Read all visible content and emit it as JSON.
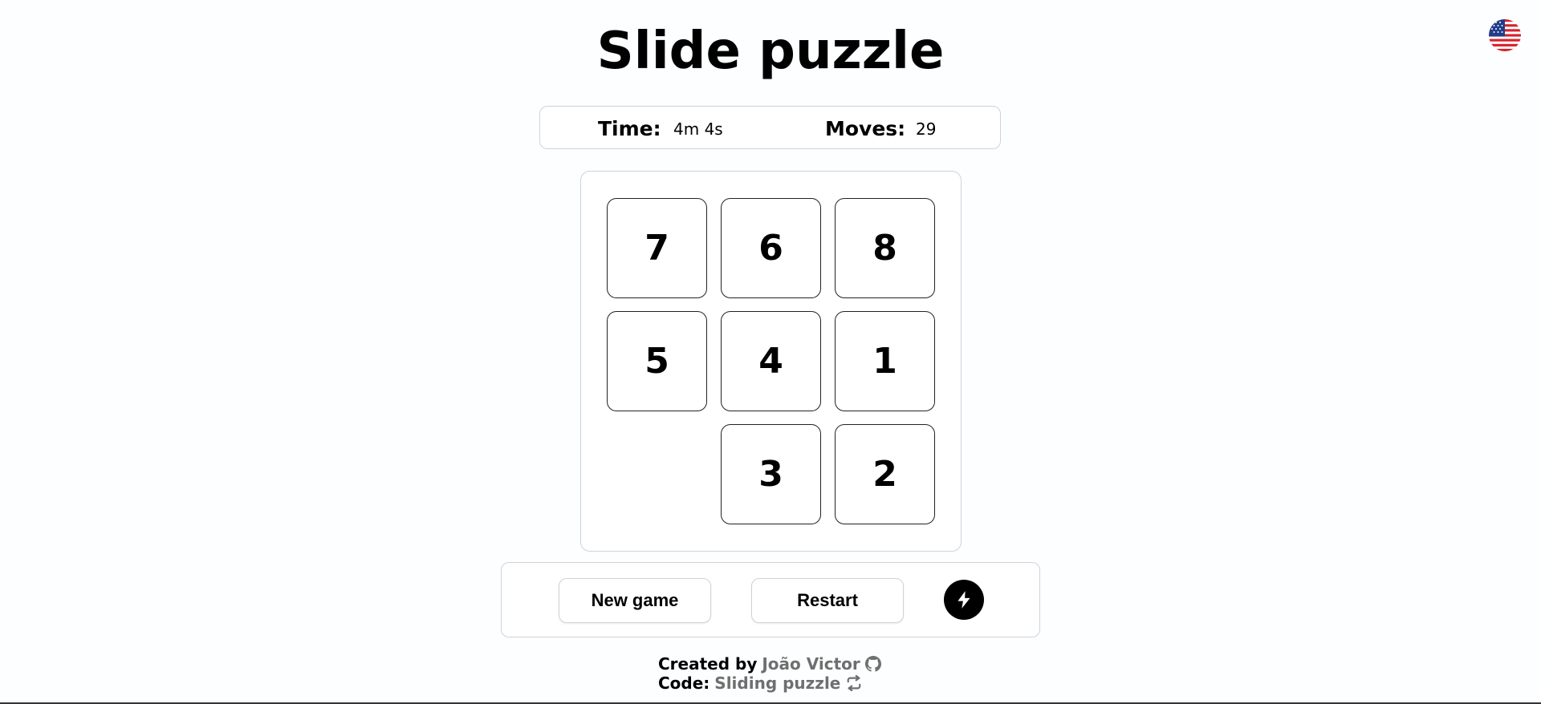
{
  "header": {
    "title": "Slide puzzle",
    "language_flag": "us-flag-icon"
  },
  "stats": {
    "time_label": "Time:",
    "time_value": "4m 4s",
    "moves_label": "Moves:",
    "moves_value": "29"
  },
  "board": {
    "grid_size": 3,
    "rows": [
      [
        "7",
        "6",
        "8"
      ],
      [
        "5",
        "4",
        "1"
      ],
      [
        "",
        "3",
        "2"
      ]
    ]
  },
  "controls": {
    "new_game_label": "New game",
    "restart_label": "Restart",
    "hint_icon": "lightning-bolt-icon"
  },
  "footer": {
    "created_by_label": "Created by",
    "author_name": "João Victor",
    "author_icon": "github-icon",
    "code_label": "Code:",
    "repo_name": "Sliding puzzle",
    "repo_icon": "repo-icon"
  }
}
